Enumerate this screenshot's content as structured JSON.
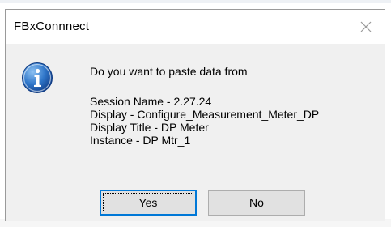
{
  "dialog": {
    "title": "FBxConnnect",
    "message": {
      "question": "Do you want to paste data from",
      "lines": [
        "Session Name - 2.27.24",
        "Display - Configure_Measurement_Meter_DP",
        "Display Title - DP Meter",
        "Instance - DP Mtr_1"
      ]
    },
    "buttons": {
      "yes": {
        "accel": "Y",
        "rest": "es"
      },
      "no": {
        "accel": "N",
        "rest": "o"
      }
    },
    "icon": "information-icon",
    "close_icon": "close-icon",
    "accent_color": "#0078d7",
    "icon_color": "#1f5fb4"
  }
}
